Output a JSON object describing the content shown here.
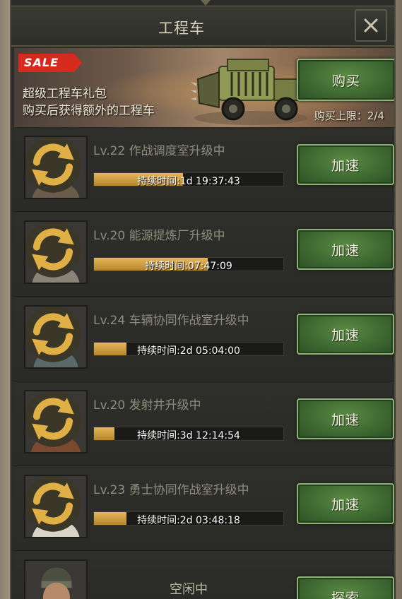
{
  "window": {
    "title": "工程车",
    "close_icon": "close-icon"
  },
  "banner": {
    "sale_label": "SALE",
    "line1": "超级工程车礼包",
    "line2": "购买后获得额外的工程车",
    "buy_label": "购买",
    "limit_text": "购买上限：2/4"
  },
  "colors": {
    "accent_green": "#3f6a32",
    "progress_gold": "#d9a844",
    "sale_red": "#d62a1e"
  },
  "slots": [
    {
      "task": "Lv.22 作战调度室升级中",
      "timer": "持续时间:1d 19:37:43",
      "progress": 0.47,
      "button": "加速"
    },
    {
      "task": "Lv.20 能源提炼厂升级中",
      "timer": "持续时间:07:47:09",
      "progress": 0.6,
      "button": "加速"
    },
    {
      "task": "Lv.24 车辆协同作战室升级中",
      "timer": "持续时间:2d 05:04:00",
      "progress": 0.17,
      "button": "加速"
    },
    {
      "task": "Lv.20 发射井升级中",
      "timer": "持续时间:3d 12:14:54",
      "progress": 0.11,
      "button": "加速"
    },
    {
      "task": "Lv.23 勇士协同作战室升级中",
      "timer": "持续时间:2d 03:48:18",
      "progress": 0.17,
      "button": "加速"
    }
  ],
  "idle_slot": {
    "status": "空闲中",
    "button": "探索"
  }
}
